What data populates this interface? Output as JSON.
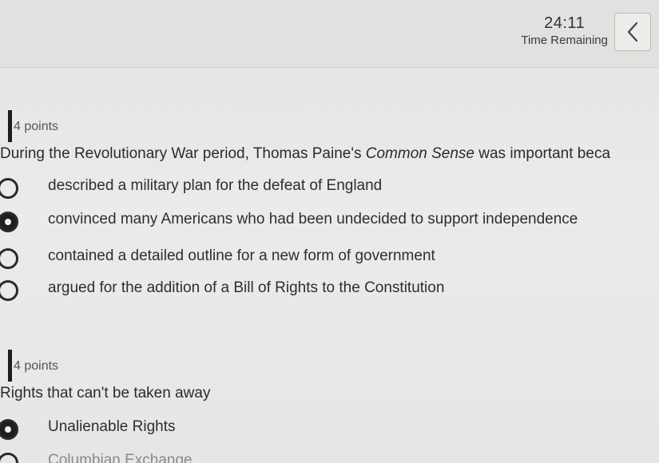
{
  "timer": {
    "value": "24:11",
    "label": "Time Remaining"
  },
  "questions": [
    {
      "points": "4 points",
      "prompt_before": "During the Revolutionary War period, Thomas Paine's ",
      "prompt_italic": "Common Sense",
      "prompt_after": " was important beca",
      "options": [
        {
          "label": "described a military plan for the defeat of England",
          "selected": false
        },
        {
          "label": "convinced many Americans who had been undecided to support independence",
          "selected": true
        },
        {
          "label": "contained a detailed outline for a new form of government",
          "selected": false
        },
        {
          "label": "argued for the addition of a Bill of Rights to the Constitution",
          "selected": false
        }
      ]
    },
    {
      "points": "4 points",
      "prompt": "Rights that can't be taken away",
      "options": [
        {
          "label": "Unalienable Rights",
          "selected": true
        },
        {
          "label": "Columbian Exchange",
          "selected": false
        }
      ]
    }
  ],
  "icons": {
    "collapse": "chevron-left-icon"
  }
}
